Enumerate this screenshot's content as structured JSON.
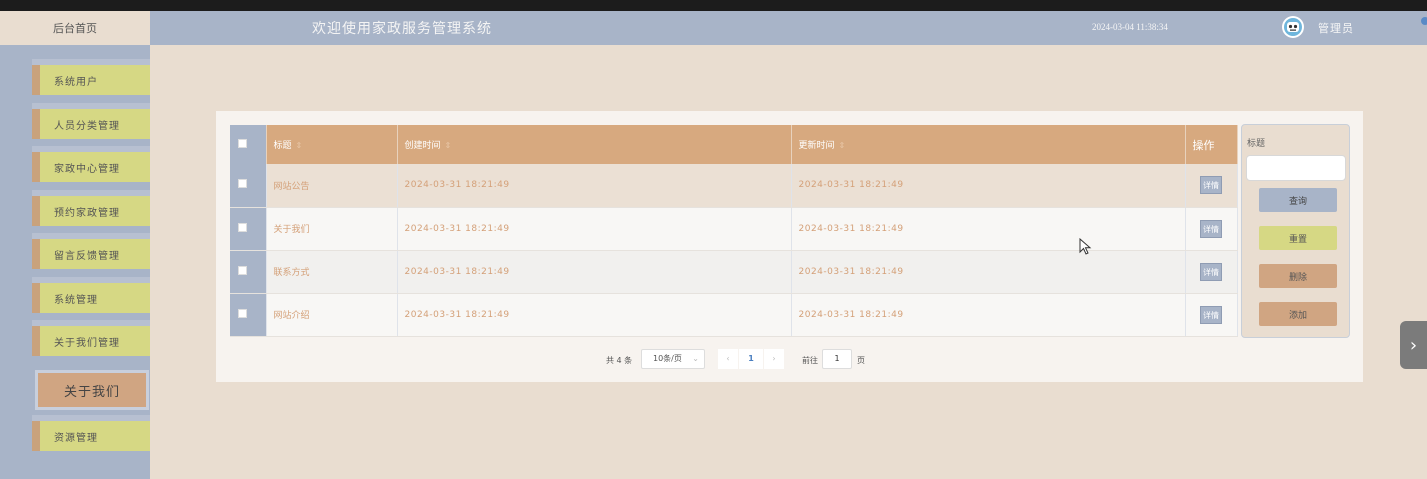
{
  "header": {
    "home_tab": "后台首页",
    "welcome": "欢迎使用家政服务管理系统",
    "datetime": "2024-03-04 11:38:34",
    "admin_label": "管理员"
  },
  "sidebar": {
    "items": [
      {
        "label": "系统用户"
      },
      {
        "label": "人员分类管理"
      },
      {
        "label": "家政中心管理"
      },
      {
        "label": "预约家政管理"
      },
      {
        "label": "留言反馈管理"
      },
      {
        "label": "系统管理"
      },
      {
        "label": "关于我们管理"
      },
      {
        "label": "关于我们"
      },
      {
        "label": "资源管理"
      }
    ]
  },
  "table": {
    "headers": {
      "title": "标题",
      "created": "创建时间",
      "updated": "更新时间",
      "action": "操作"
    },
    "rows": [
      {
        "title": "网站公告",
        "created": "2024-03-31 18:21:49",
        "updated": "2024-03-31 18:21:49",
        "action": "详情"
      },
      {
        "title": "关于我们",
        "created": "2024-03-31 18:21:49",
        "updated": "2024-03-31 18:21:49",
        "action": "详情"
      },
      {
        "title": "联系方式",
        "created": "2024-03-31 18:21:49",
        "updated": "2024-03-31 18:21:49",
        "action": "详情"
      },
      {
        "title": "网站介绍",
        "created": "2024-03-31 18:21:49",
        "updated": "2024-03-31 18:21:49",
        "action": "详情"
      }
    ]
  },
  "search": {
    "label": "标题",
    "input_value": "",
    "query_label": "查询",
    "reset_label": "重置",
    "delete_label": "删除",
    "add_label": "添加"
  },
  "pagination": {
    "total": "共 4 条",
    "page_size": "10条/页",
    "current_page": "1",
    "goto_label": "前往",
    "goto_value": "1",
    "page_unit": "页"
  },
  "colors": {
    "header_bg": "#a8b4c8",
    "menu_bg": "#d6d884",
    "accent": "#d0a582",
    "page_bg": "#e9ddd0"
  }
}
